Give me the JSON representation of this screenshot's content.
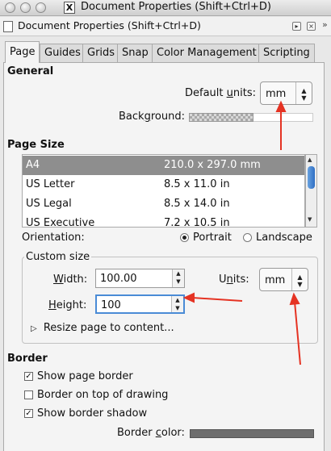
{
  "window": {
    "title": "Document Properties (Shift+Ctrl+D)",
    "app_icon_label": "X",
    "dock_title": "Document Properties (Shift+Ctrl+D)"
  },
  "tabs": [
    {
      "label": "Page",
      "active": true
    },
    {
      "label": "Guides"
    },
    {
      "label": "Grids"
    },
    {
      "label": "Snap"
    },
    {
      "label": "Color Management"
    },
    {
      "label": "Scripting"
    }
  ],
  "general": {
    "heading": "General",
    "default_units_label": "Default units:",
    "default_units_value": "mm",
    "background_label": "Background:"
  },
  "page_size": {
    "heading": "Page Size",
    "rows": [
      {
        "name": "A4",
        "size": "210.0 x 297.0 mm",
        "selected": true
      },
      {
        "name": "US Letter",
        "size": "8.5 x 11.0 in"
      },
      {
        "name": "US Legal",
        "size": "8.5 x 14.0 in"
      },
      {
        "name": "US Executive",
        "size": "7.2 x 10.5 in"
      }
    ],
    "orientation_label": "Orientation:",
    "portrait_label": "Portrait",
    "landscape_label": "Landscape",
    "orientation_value": "Portrait"
  },
  "custom_size": {
    "legend": "Custom size",
    "width_label": "Width:",
    "width_value": "100.00",
    "height_label": "Height:",
    "height_value": "100",
    "units_label": "Units:",
    "units_value": "mm",
    "resize_label": "Resize page to content..."
  },
  "border": {
    "heading": "Border",
    "show_page_border": {
      "label": "Show page border",
      "checked": true
    },
    "border_on_top": {
      "label": "Border on top of drawing",
      "checked": false
    },
    "show_border_shadow": {
      "label": "Show border shadow",
      "checked": true
    },
    "border_color_label": "Border color:"
  },
  "colors": {
    "annotation_arrow": "#e53323",
    "selected_row": "#8e8e8e",
    "focus_ring": "#4a8bd6",
    "border_color_swatch": "#6e6e6e"
  }
}
